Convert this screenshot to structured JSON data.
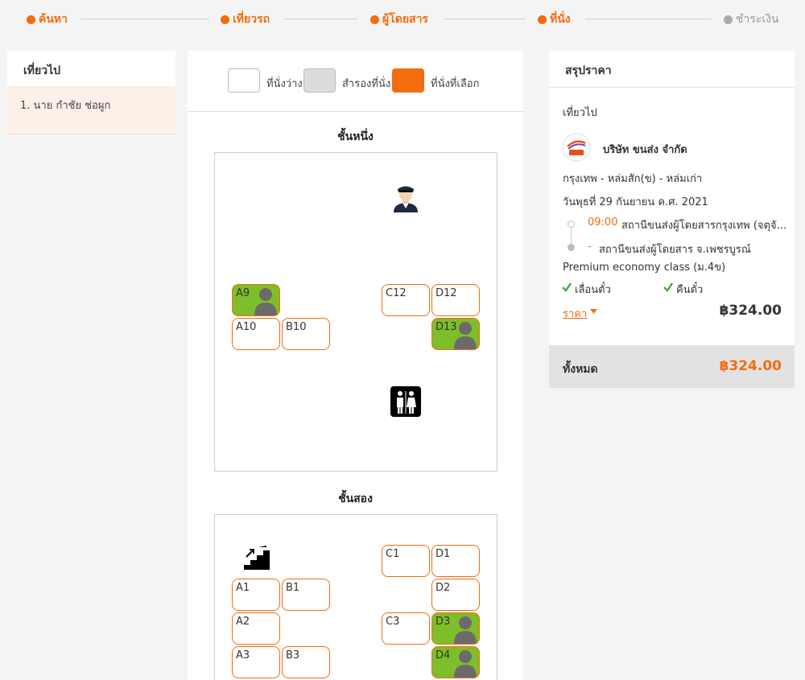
{
  "steps": [
    {
      "label": "ค้นหา"
    },
    {
      "label": "เที่ยวรถ"
    },
    {
      "label": "ผู้โดยสาร"
    },
    {
      "label": "ที่นั่ง"
    },
    {
      "label": "ชำระเงิน"
    }
  ],
  "left": {
    "title": "เที่ยวไป",
    "passenger": "1. นาย กำชัย ช่อผูก"
  },
  "legend": {
    "available": "ที่นั่งว่าง",
    "reserved": "สำรองที่นั่ง",
    "selected": "ที่นั่งที่เลือก"
  },
  "colors": {
    "accent": "#f36c0d",
    "booked": "#7dbe2a",
    "reserved": "#dcdcdc"
  },
  "decks": {
    "first_title": "ชั้นหนึ่ง",
    "second_title": "ชั้นสอง"
  },
  "seats": {
    "first": [
      {
        "label": "A9",
        "booked": true
      },
      {
        "label": "C12",
        "booked": false
      },
      {
        "label": "D12",
        "booked": false
      },
      {
        "label": "A10",
        "booked": false
      },
      {
        "label": "B10",
        "booked": false
      },
      {
        "label": "D13",
        "booked": true
      }
    ],
    "second": [
      {
        "label": "C1",
        "booked": false
      },
      {
        "label": "D1",
        "booked": false
      },
      {
        "label": "A1",
        "booked": false
      },
      {
        "label": "B1",
        "booked": false
      },
      {
        "label": "D2",
        "booked": false
      },
      {
        "label": "A2",
        "booked": false
      },
      {
        "label": "C3",
        "booked": false
      },
      {
        "label": "D3",
        "booked": true
      },
      {
        "label": "A3",
        "booked": false
      },
      {
        "label": "B3",
        "booked": false
      },
      {
        "label": "D4",
        "booked": true
      }
    ]
  },
  "icons": {
    "driver": "driver-icon",
    "toilet": "toilet-icon",
    "stairs": "stairs-icon",
    "seat_person": "person-icon",
    "operator_logo": "bus-company-logo-icon",
    "check": "check-icon",
    "price_toggle": "caret-down-icon"
  },
  "summary": {
    "title": "สรุปราคา",
    "trip_label": "เที่ยวไป",
    "company": "บริษัท ขนส่ง จำกัด",
    "route": "กรุงเทพ - หล่มสัก(ข) - หล่มเก่า",
    "date": "วันพุธที่ 29 กันยายน ค.ศ. 2021",
    "depart_time": "09:00",
    "depart_station": "สถานีขนส่งผู้โดยสารกรุงเทพ (จตุจั...",
    "arrive_time": "-",
    "arrive_station": "สถานีขนส่งผู้โดยสาร จ.เพชรบูรณ์",
    "bus_class": "Premium economy class (ม.4ข)",
    "feature1": "เลื่อนตั๋ว",
    "feature2": "คืนตั๋ว",
    "price_label": "ราคา",
    "price_value": "฿324.00",
    "total_label": "ทั้งหมด",
    "total_value": "฿324.00"
  }
}
